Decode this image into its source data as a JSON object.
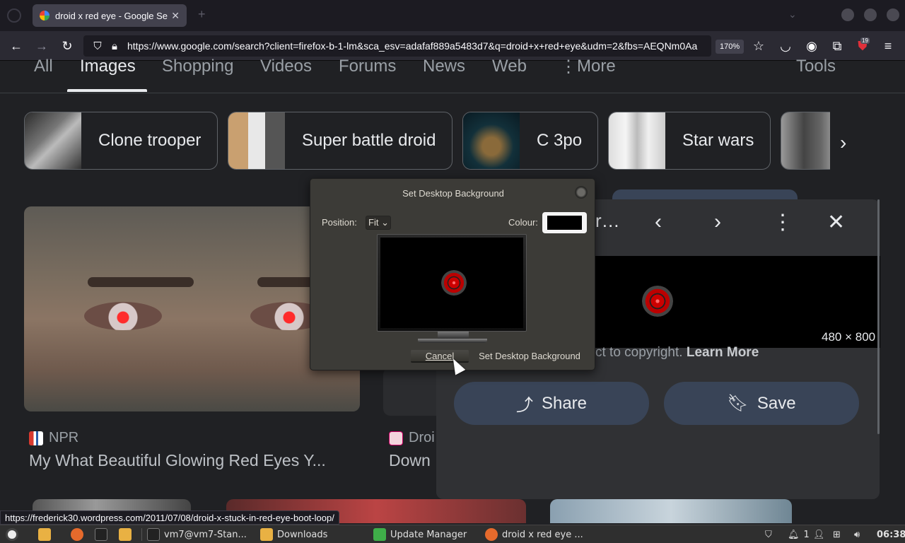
{
  "browser": {
    "tab_title": "droid x red eye - Google Se",
    "tab_close": "✕",
    "url": "https://www.google.com/search?client=firefox-b-1-lm&sca_esv=adafaf889a5483d7&q=droid+x+red+eye&udm=2&fbs=AEQNm0Aa",
    "zoom": "170%",
    "extension_badge": "19"
  },
  "google": {
    "tabs": [
      "All",
      "Images",
      "Shopping",
      "Videos",
      "Forums",
      "News",
      "Web",
      "More",
      "Tools"
    ],
    "active_tab": "Images",
    "chips": [
      "Clone trooper",
      "Super battle droid",
      "C 3po",
      "Star wars"
    ],
    "results": [
      {
        "source": "NPR",
        "title": "My What Beautiful Glowing Red Eyes Y..."
      },
      {
        "source": "Droi",
        "title": "Down"
      }
    ]
  },
  "preview": {
    "title_fragment": "r…",
    "dimensions": "480 × 800",
    "copyright_text": "ct to copyright.",
    "learn_more": "Learn More",
    "share_label": "Share",
    "save_label": "Save"
  },
  "dialog": {
    "title": "Set Desktop Background",
    "position_label": "Position:",
    "position_value": "Fit",
    "colour_label": "Colour:",
    "colour_value": "#000000",
    "cancel_label": "Cancel",
    "set_label": "Set Desktop Background"
  },
  "status_url": "https://frederick30.wordpress.com/2011/07/08/droid-x-stuck-in-red-eye-boot-loop/",
  "taskbar": {
    "terminal_label": "vm7@vm7-Stan...",
    "downloads_label": "Downloads",
    "update_label": "Update Manager",
    "firefox_label": "droid x red eye ...",
    "notif_count": "1",
    "clock": "06:38"
  }
}
